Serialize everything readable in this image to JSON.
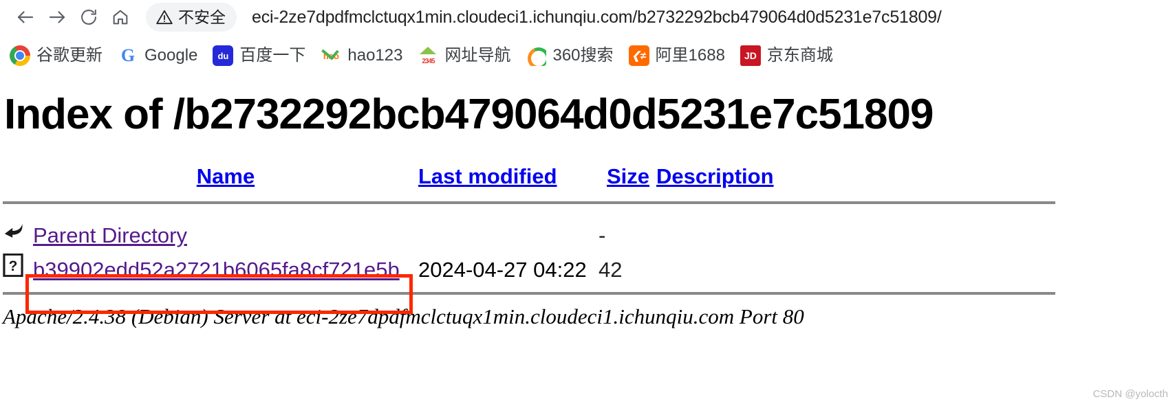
{
  "browser": {
    "nav": {
      "back_label": "Back",
      "forward_label": "Forward",
      "reload_label": "Reload",
      "home_label": "Home"
    },
    "omnibox": {
      "security_label": "不安全",
      "security_icon": "warning-triangle-icon",
      "url": "eci-2ze7dpdfmclctuqx1min.cloudeci1.ichunqiu.com/b2732292bcb479064d0d5231e7c51809/"
    },
    "bookmarks": [
      {
        "label": "谷歌更新",
        "icon": "chrome-icon"
      },
      {
        "label": "Google",
        "icon": "google-icon"
      },
      {
        "label": "百度一下",
        "icon": "baidu-icon"
      },
      {
        "label": "hao123",
        "icon": "hao123-icon"
      },
      {
        "label": "网址导航",
        "icon": "2345-navigation-icon"
      },
      {
        "label": "360搜索",
        "icon": "360-search-icon"
      },
      {
        "label": "阿里1688",
        "icon": "alibaba-1688-icon"
      },
      {
        "label": "京东商城",
        "icon": "jd-icon"
      }
    ]
  },
  "page": {
    "title": "Index of /b2732292bcb479064d0d5231e7c51809",
    "columns": {
      "name": "Name",
      "last_modified": "Last modified",
      "size": "Size",
      "description": "Description"
    },
    "rows": [
      {
        "icon": "parent-directory-icon",
        "name": "Parent Directory",
        "last_modified": "",
        "size": "-",
        "description": ""
      },
      {
        "icon": "unknown-file-icon",
        "name": "b39902edd52a2721b6065fa8cf721e5b",
        "last_modified": "2024-04-27 04:22",
        "size": "42",
        "description": ""
      }
    ],
    "footer": "Apache/2.4.38 (Debian) Server at eci-2ze7dpdfmclctuqx1min.cloudeci1.ichunqiu.com Port 80"
  },
  "annotation": {
    "highlight_color": "#fc2800",
    "target": "b39902edd52a2721b6065fa8cf721e5b"
  },
  "watermark": "CSDN @yolocth"
}
